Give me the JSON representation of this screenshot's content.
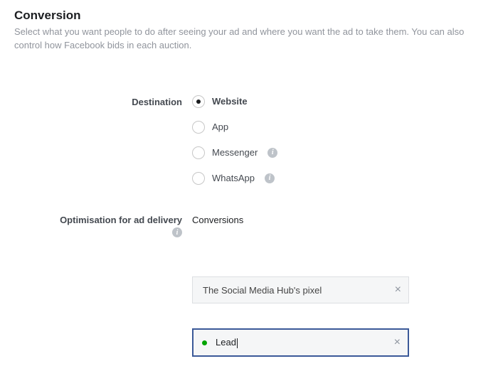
{
  "section": {
    "title": "Conversion",
    "description": "Select what you want people to do after seeing your ad and where you want the ad to take them. You can also control how Facebook bids in each auction."
  },
  "destination": {
    "label": "Destination",
    "options": [
      {
        "label": "Website",
        "selected": true,
        "info": false
      },
      {
        "label": "App",
        "selected": false,
        "info": false
      },
      {
        "label": "Messenger",
        "selected": false,
        "info": true
      },
      {
        "label": "WhatsApp",
        "selected": false,
        "info": true
      }
    ]
  },
  "optimisation": {
    "label": "Optimisation for ad delivery",
    "value": "Conversions"
  },
  "pixel": {
    "value": "The Social Media Hub's pixel"
  },
  "event": {
    "value": "Lead",
    "status_color": "#00a400"
  },
  "icons": {
    "info_glyph": "i",
    "close_glyph": "×"
  }
}
